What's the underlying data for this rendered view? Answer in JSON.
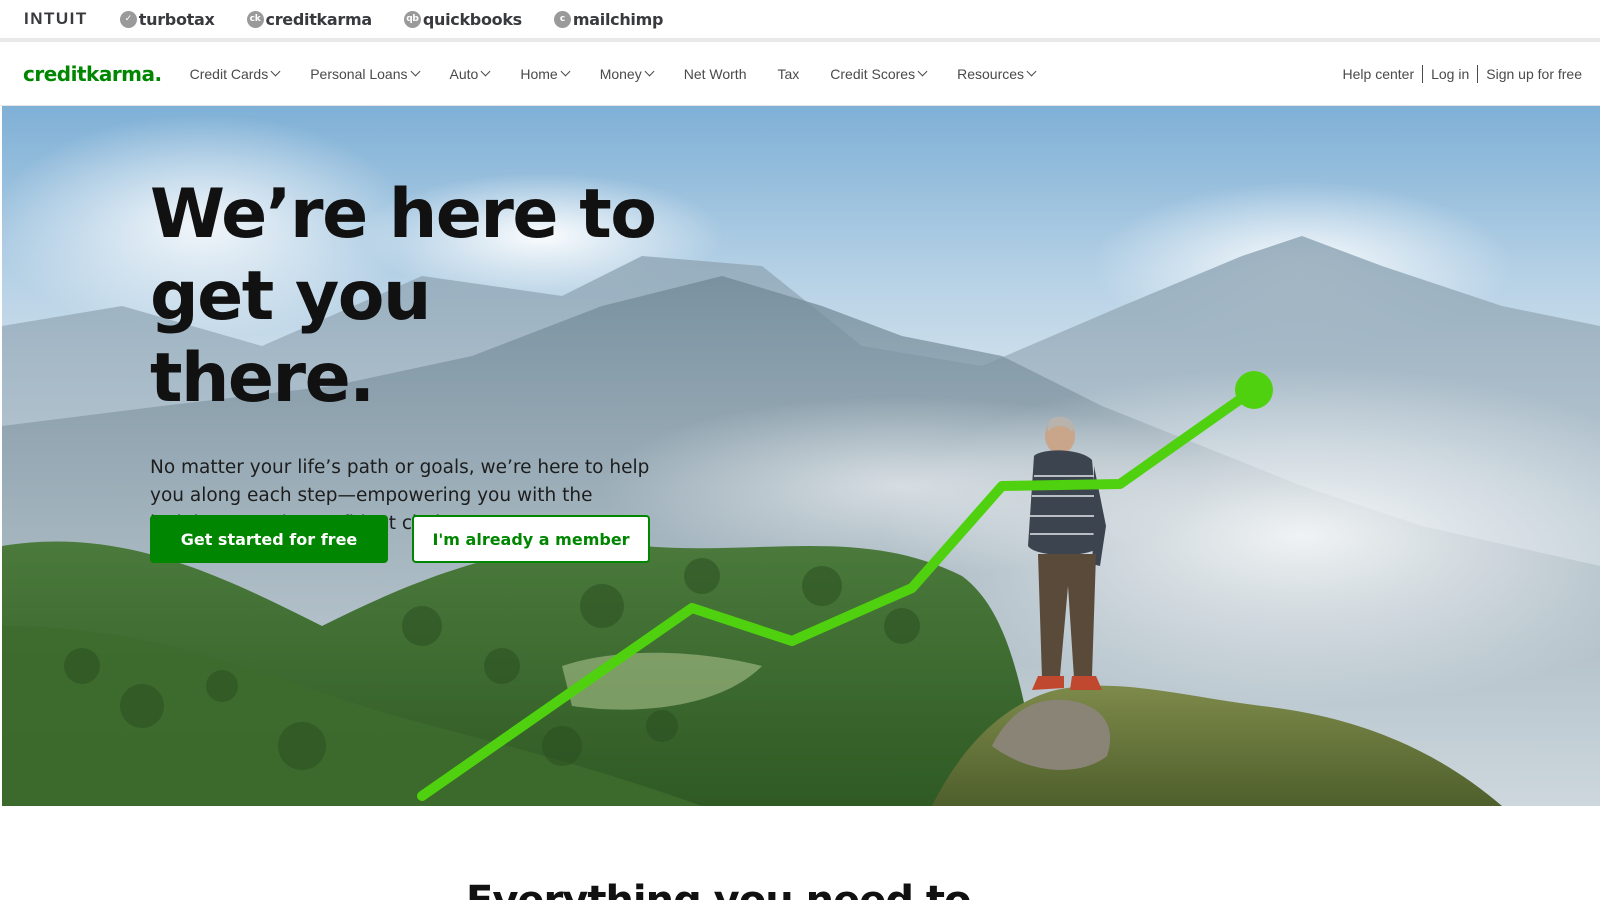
{
  "family_bar": {
    "intuit_label": "INTUIT",
    "products": [
      {
        "label": "turbotax",
        "icon": "check-circle-icon",
        "icon_glyph": "✓"
      },
      {
        "label": "creditkarma",
        "icon": "creditkarma-logo-icon",
        "icon_glyph": "ck"
      },
      {
        "label": "quickbooks",
        "icon": "quickbooks-logo-icon",
        "icon_glyph": "qb"
      },
      {
        "label": "mailchimp",
        "icon": "mailchimp-logo-icon",
        "icon_glyph": "c"
      }
    ]
  },
  "nav": {
    "brand": "creditkarma",
    "brand_dot": ".",
    "items": [
      {
        "label": "Credit Cards",
        "has_dropdown": true
      },
      {
        "label": "Personal Loans",
        "has_dropdown": true
      },
      {
        "label": "Auto",
        "has_dropdown": true
      },
      {
        "label": "Home",
        "has_dropdown": true
      },
      {
        "label": "Money",
        "has_dropdown": true
      },
      {
        "label": "Net Worth",
        "has_dropdown": false
      },
      {
        "label": "Tax",
        "has_dropdown": false
      },
      {
        "label": "Credit Scores",
        "has_dropdown": true
      },
      {
        "label": "Resources",
        "has_dropdown": true
      }
    ],
    "help": "Help center",
    "login": "Log in",
    "signup": "Sign up for free"
  },
  "hero": {
    "title_line1": "We’re here to",
    "title_line2": "get you there.",
    "subtitle": "No matter your life’s path or goals, we’re here to help you along each step—empowering you with the insights to make confident choices.",
    "primary_cta": "Get started for free",
    "secondary_cta": "I'm already a member"
  },
  "next_section": {
    "heading": "Everything you need to"
  },
  "colors": {
    "brand_green": "#008600",
    "chart_line_green": "#4fd10f"
  }
}
